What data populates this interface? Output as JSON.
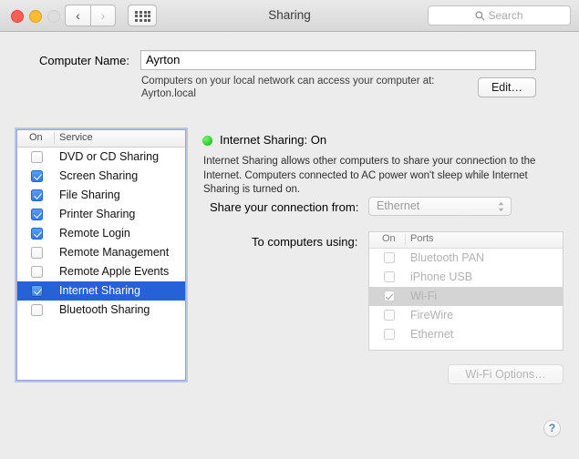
{
  "window": {
    "title": "Sharing",
    "traffic_lights": [
      "close",
      "minimize",
      "zoom"
    ],
    "nav_back": "‹",
    "nav_forward": "›",
    "show_all_icon": "grid-icon"
  },
  "search": {
    "placeholder": "Search",
    "icon": "search-icon"
  },
  "computer_name": {
    "label": "Computer Name:",
    "value": "Ayrton",
    "description_line1": "Computers on your local network can access your computer at:",
    "description_line2": "Ayrton.local",
    "edit_label": "Edit…"
  },
  "services": {
    "header_on": "On",
    "header_service": "Service",
    "items": [
      {
        "label": "DVD or CD Sharing",
        "checked": false,
        "selected": false
      },
      {
        "label": "Screen Sharing",
        "checked": true,
        "selected": false
      },
      {
        "label": "File Sharing",
        "checked": true,
        "selected": false
      },
      {
        "label": "Printer Sharing",
        "checked": true,
        "selected": false
      },
      {
        "label": "Remote Login",
        "checked": true,
        "selected": false
      },
      {
        "label": "Remote Management",
        "checked": false,
        "selected": false
      },
      {
        "label": "Remote Apple Events",
        "checked": false,
        "selected": false
      },
      {
        "label": "Internet Sharing",
        "checked": true,
        "selected": true
      },
      {
        "label": "Bluetooth Sharing",
        "checked": false,
        "selected": false
      }
    ]
  },
  "detail": {
    "status_text": "Internet Sharing: On",
    "status_color": "#2dd62d",
    "description": "Internet Sharing allows other computers to share your connection to the Internet. Computers connected to AC power won't sleep while Internet Sharing is turned on.",
    "share_from_label": "Share your connection from:",
    "share_from_value": "Ethernet",
    "to_computers_label": "To computers using:",
    "ports_header_on": "On",
    "ports_header_ports": "Ports",
    "ports": [
      {
        "label": "Bluetooth PAN",
        "checked": false,
        "highlight": false
      },
      {
        "label": "iPhone USB",
        "checked": false,
        "highlight": false
      },
      {
        "label": "Wi-Fi",
        "checked": true,
        "highlight": true
      },
      {
        "label": "FireWire",
        "checked": false,
        "highlight": false
      },
      {
        "label": "Ethernet",
        "checked": false,
        "highlight": false
      }
    ],
    "wifi_options_label": "Wi-Fi Options…"
  },
  "help": {
    "label": "?"
  },
  "colors": {
    "selection_blue": "#2661d8",
    "accent_green": "#2dd62d",
    "window_bg": "#ececec"
  }
}
